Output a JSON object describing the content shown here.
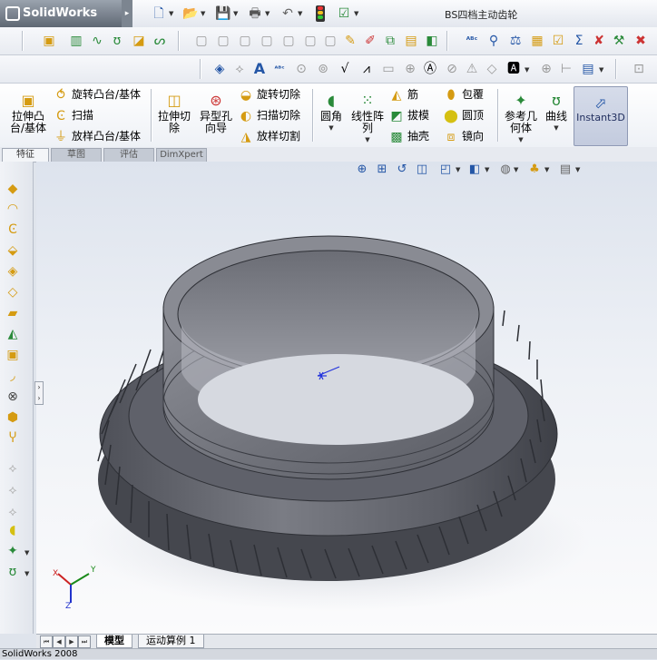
{
  "app": {
    "logo_text": "SolidWorks",
    "document_title": "BS四档主动齿轮"
  },
  "command_manager": {
    "extrude_boss": "拉伸凸\n台/基体",
    "revolve_boss": "旋转凸台/基体",
    "sweep": "扫描",
    "loft_boss": "放样凸台/基体",
    "extrude_cut": "拉伸切\n除",
    "hole_wizard": "异型孔\n向导",
    "revolve_cut": "旋转切除",
    "sweep_cut": "扫描切除",
    "loft_cut": "放样切割",
    "fillet": "圆角",
    "linear_pattern": "线性阵\n列",
    "rib": "筋",
    "draft": "拔模",
    "shell": "抽壳",
    "wrap": "包覆",
    "dome": "圆顶",
    "mirror": "镜向",
    "ref_geometry": "参考几\n何体",
    "curves": "曲线",
    "instant3d": "Instant3D"
  },
  "tabs": [
    "特征",
    "草图",
    "评估",
    "DimXpert"
  ],
  "bottom_tabs": [
    "模型",
    "运动算例 1"
  ],
  "status_bar": "SolidWorks 2008",
  "triad": {
    "x": "X",
    "y": "Y",
    "z": "Z"
  },
  "colors": {
    "accent": "#2456a6",
    "gear": "#6f7179",
    "background_top": "#dde3ed"
  }
}
